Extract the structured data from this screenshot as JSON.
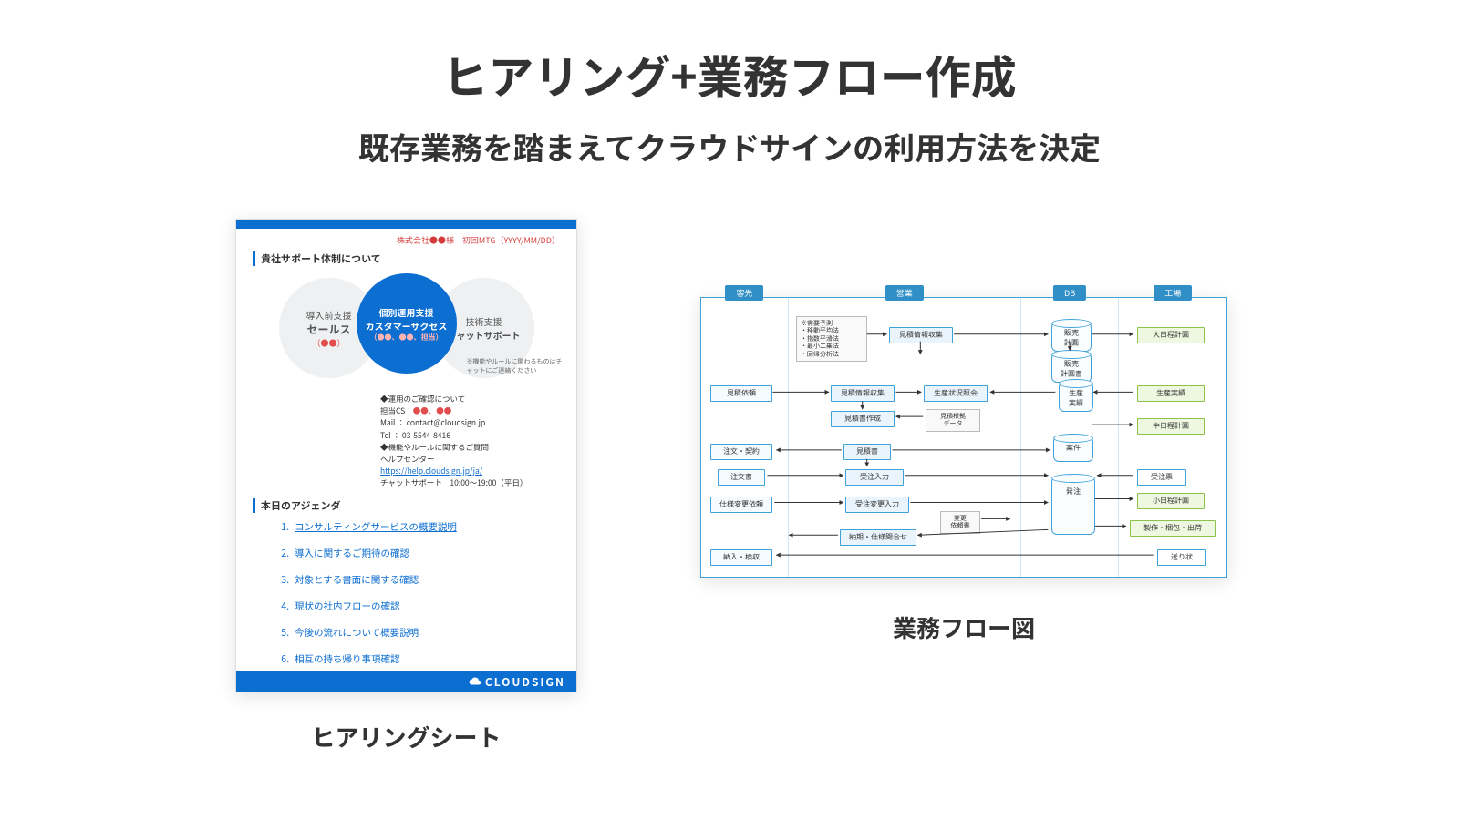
{
  "title": "ヒアリング+業務フロー作成",
  "subtitle": "既存業務を踏まえてクラウドサインの利用方法を決定",
  "captions": {
    "left": "ヒアリングシート",
    "right": "業務フロー図"
  },
  "sheet": {
    "meta": "株式会社●●様　初回MTG（YYYY/MM/DD）",
    "section1": "貴社サポート体制について",
    "circles": {
      "left": {
        "line1": "導入前支援",
        "line2": "セールス",
        "red": "（●●）"
      },
      "center": {
        "line1": "個別運用支援",
        "line2": "カスタマーサクセス",
        "red": "（●●、●●、担当）"
      },
      "right": {
        "line1": "技術支援",
        "line2": "チャットサポート"
      },
      "note": "※機能やルールに関わるものはチャットにご連絡ください"
    },
    "contact": {
      "l1": "◆運用のご確認について",
      "l2a": "担当CS：",
      "l2b": "●●、●●",
      "l3": "Mail ： contact@cloudsign.jp",
      "l4": "Tel   ： 03-5544-8416",
      "l5": "◆機能やルールに関するご質問",
      "l6a": "ヘルプセンター　",
      "l6b": "https://help.cloudsign.jp/ja/",
      "l7": "チャットサポート　10:00〜19:00（平日）"
    },
    "section2": "本日のアジェンダ",
    "agenda": [
      {
        "n": "1.",
        "t": "コンサルティングサービスの概要説明",
        "u": true
      },
      {
        "n": "2.",
        "t": "導入に関するご期待の確認"
      },
      {
        "n": "3.",
        "t": "対象とする書面に関する確認"
      },
      {
        "n": "4.",
        "t": "現状の社内フローの確認"
      },
      {
        "n": "5.",
        "t": "今後の流れについて概要説明"
      },
      {
        "n": "6.",
        "t": "相互の持ち帰り事項確認"
      }
    ],
    "brand": "CLOUDSIGN"
  },
  "flow": {
    "lanes": [
      "客先",
      "営業",
      "DB",
      "工場"
    ],
    "l0": {
      "b1": "見積依頼",
      "b2": "注文・契約",
      "b3": "注文書",
      "b4": "仕様変更依頼",
      "b5": "納入・検収"
    },
    "l1": {
      "n1": "※需要予測\n・移動平均法\n・指数平滑法\n・最小二乗法\n・回帰分析法",
      "b1": "見積情報収集",
      "b2": "見積情報収集",
      "b3": "生産状況照会",
      "b4": "見積書作成",
      "n2": "見積根拠\nデータ",
      "b5": "見積書",
      "b6": "受注入力",
      "b7": "受注変更入力",
      "b8": "変更\n依頼書",
      "b9": "納期・仕様問合せ"
    },
    "l2": {
      "c1": "販売\n計画",
      "c2": "販売\n計画書",
      "c3": "生産\n実績",
      "c4": "案件",
      "c5": "発注"
    },
    "l3": {
      "g1": "大日程計画",
      "g2": "生産実績",
      "g3": "中日程計画",
      "b1": "受注票",
      "g4": "小日程計画",
      "g5": "製作・梱包・出荷",
      "b2": "送り状"
    }
  }
}
